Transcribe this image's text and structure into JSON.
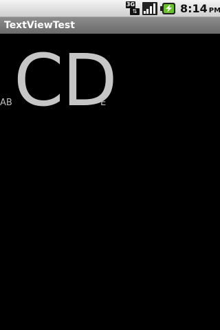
{
  "status_bar": {
    "network_label": "3G",
    "network_arrows": "⇅",
    "time": "8:14",
    "ampm": "PM",
    "signal_icon": "signal-bars-icon",
    "battery_icon": "charging-battery-icon"
  },
  "title_bar": {
    "title": "TextViewTest"
  },
  "content": {
    "text_before": "AB",
    "text_large": "CD",
    "text_after": "E"
  },
  "colors": {
    "background": "#000000",
    "title_bar": "#7a7a7a",
    "status_bar": "#e0e0e0",
    "large_text": "#c6c6c6",
    "small_text": "#bdbdbd"
  }
}
